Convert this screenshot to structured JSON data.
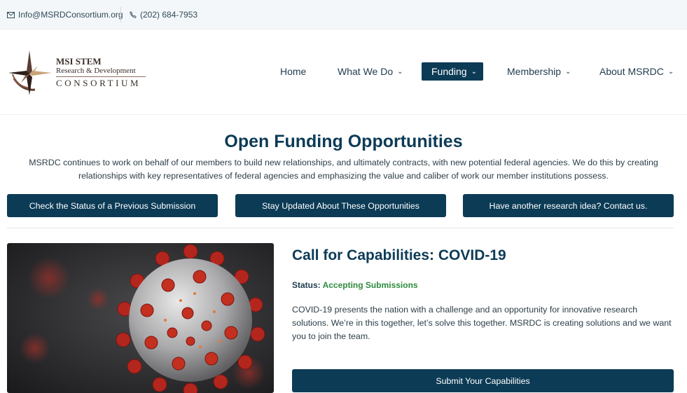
{
  "topbar": {
    "email": "Info@MSRDConsortium.org",
    "phone": "(202) 684-7953"
  },
  "logo": {
    "line1": "MSI STEM",
    "line2": "Research & Development",
    "line3": "CONSORTIUM"
  },
  "nav": {
    "items": [
      {
        "label": "Home"
      },
      {
        "label": "What We Do"
      },
      {
        "label": "Funding"
      },
      {
        "label": "Membership"
      },
      {
        "label": "About MSRDC"
      }
    ]
  },
  "main": {
    "title": "Open Funding Opportunities",
    "intro": "MSRDC continues to work on behalf of our members to build new relationships, and ultimately contracts, with new potential federal agencies. We do this by creating relationships with key representatives of federal agencies and emphasizing the value and caliber of work our member institutions possess.",
    "buttons": [
      {
        "label": "Check the Status of a Previous Submission"
      },
      {
        "label": "Stay Updated About These Opportunities"
      },
      {
        "label": "Have another research idea? Contact us."
      }
    ]
  },
  "opportunity": {
    "title": "Call for Capabilities: COVID-19",
    "status_label": "Status:",
    "status_value": "Accepting Submissions",
    "description": "COVID-19 presents the nation with a challenge and an opportunity for innovative research solutions. We’re in this together, let’s solve this together. MSRDC is creating solutions and we want you to join the team.",
    "submit_label": "Submit Your Capabilities"
  },
  "colors": {
    "primary": "#0c3b56",
    "status_green": "#2e8b3e",
    "topbar_bg": "#f4f7f9"
  },
  "icons": {
    "email": "envelope-icon",
    "phone": "phone-icon",
    "dropdown": "chevron-down-icon"
  }
}
